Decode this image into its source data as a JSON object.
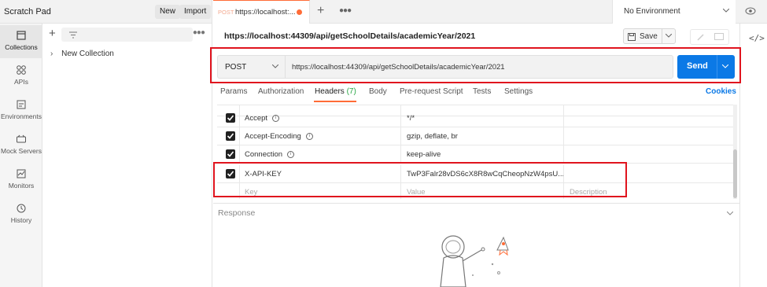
{
  "workspace": {
    "name": "Scratch Pad",
    "new_label": "New",
    "import_label": "Import"
  },
  "rail": {
    "items": [
      {
        "label": "Collections",
        "icon": "collections-icon",
        "active": true
      },
      {
        "label": "APIs",
        "icon": "apis-icon"
      },
      {
        "label": "Environments",
        "icon": "environments-icon"
      },
      {
        "label": "Mock Servers",
        "icon": "mock-servers-icon"
      },
      {
        "label": "Monitors",
        "icon": "monitors-icon"
      },
      {
        "label": "History",
        "icon": "history-icon"
      }
    ]
  },
  "collections": {
    "items": [
      {
        "label": "New Collection"
      }
    ]
  },
  "tabbar": {
    "tab": {
      "method": "POST",
      "title": "https://localhost:..."
    },
    "environment": "No Environment"
  },
  "request": {
    "title": "https://localhost:44309/api/getSchoolDetails/academicYear/2021",
    "method": "POST",
    "url": "https://localhost:44309/api/getSchoolDetails/academicYear/2021",
    "save_label": "Save",
    "send_label": "Send",
    "tabs": [
      {
        "label": "Params"
      },
      {
        "label": "Authorization"
      },
      {
        "label": "Headers",
        "count": "(7)",
        "active": true
      },
      {
        "label": "Body"
      },
      {
        "label": "Pre-request Script"
      },
      {
        "label": "Tests"
      },
      {
        "label": "Settings"
      }
    ],
    "cookies_label": "Cookies"
  },
  "headers": {
    "rows": [
      {
        "key": "Accept",
        "value": "*/*",
        "info": true
      },
      {
        "key": "Accept-Encoding",
        "value": "gzip, deflate, br",
        "info": true
      },
      {
        "key": "Connection",
        "value": "keep-alive",
        "info": true
      },
      {
        "key": "X-API-KEY",
        "value": "TwP3Falr28vDS6cX8R8wCqCheopNzW4psU...",
        "info": false
      }
    ],
    "placeholder": {
      "key": "Key",
      "value": "Value",
      "description": "Description"
    }
  },
  "response": {
    "label": "Response"
  },
  "colors": {
    "accent": "#ff6c37",
    "send": "#0b79e6",
    "highlight": "#e0141e"
  }
}
